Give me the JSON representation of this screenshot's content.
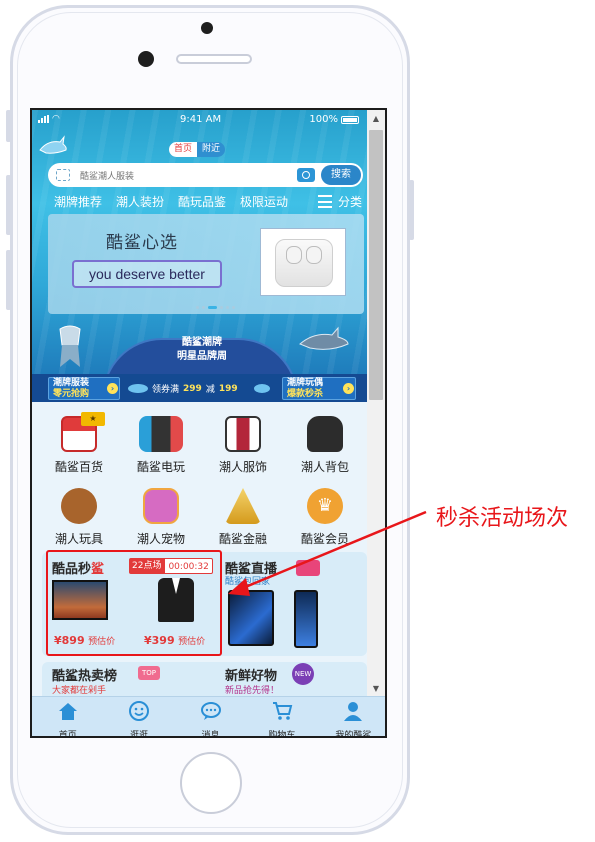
{
  "statusbar": {
    "time": "9:41 AM",
    "battery": "100%"
  },
  "top_tabs": {
    "home": "首页",
    "nearby": "附近"
  },
  "search": {
    "placeholder": "酷鲨潮人服装",
    "button": "搜索"
  },
  "category_nav": [
    "潮牌推荐",
    "潮人装扮",
    "酷玩品鉴",
    "极限运动"
  ],
  "category_more": "分类",
  "banner": {
    "title": "酷鲨心选",
    "slogan": "you deserve better"
  },
  "promo": {
    "dome_line1": "酷鲨潮牌",
    "dome_line2": "明星品牌周",
    "left_line1": "潮牌服装",
    "left_line2": "零元抢购",
    "coupon_prefix": "领券满",
    "coupon_threshold": "299",
    "coupon_mid": "减",
    "coupon_amount": "199",
    "right_line1": "潮牌玩偶",
    "right_line2": "爆款秒杀"
  },
  "grid": [
    {
      "label": "酷鲨百货",
      "icon": "store-icon"
    },
    {
      "label": "酷鲨电玩",
      "icon": "game-console-icon"
    },
    {
      "label": "潮人服饰",
      "icon": "suit-icon"
    },
    {
      "label": "潮人背包",
      "icon": "backpack-icon"
    },
    {
      "label": "潮人玩具",
      "icon": "teddy-bear-icon"
    },
    {
      "label": "潮人宠物",
      "icon": "pet-icon"
    },
    {
      "label": "酷鲨金融",
      "icon": "gold-bars-icon"
    },
    {
      "label": "酷鲨会员",
      "icon": "crown-icon"
    }
  ],
  "flash_sale": {
    "title_a": "酷品秒",
    "title_b": "鲨",
    "session": "22点场",
    "countdown": "00:00:32",
    "items": [
      {
        "price": "¥899",
        "note": "预估价"
      },
      {
        "price": "¥399",
        "note": "预估价"
      }
    ]
  },
  "live": {
    "title": "酷鲨直播",
    "subtitle": "酷鲨包回家"
  },
  "hot": {
    "title": "酷鲨热卖榜",
    "subtitle": "大家都在剁手",
    "tag": "TOP"
  },
  "fresh": {
    "title": "新鲜好物",
    "subtitle": "新品抢先得！",
    "tag": "NEW"
  },
  "tabbar": [
    "首页",
    "逛逛",
    "消息",
    "购物车",
    "我的酷鲨"
  ],
  "annotation": "秒杀活动场次",
  "colors": {
    "accent_red": "#e8161a",
    "brand_blue": "#2b86c9"
  }
}
